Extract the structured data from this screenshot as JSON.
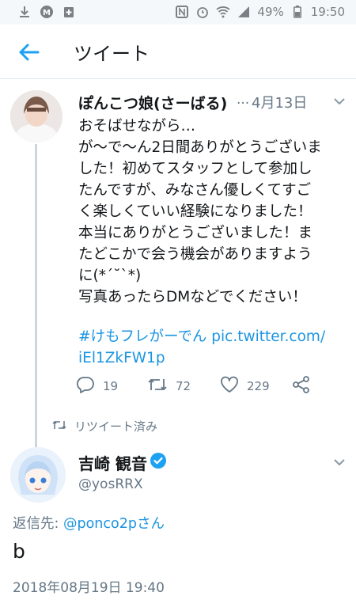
{
  "status_bar": {
    "battery": "49%",
    "time": "19:50",
    "icons": [
      "download-icon",
      "m-icon",
      "plus-box-icon",
      "nfc-icon",
      "alarm-icon",
      "wifi-icon",
      "signal-icon",
      "battery-icon"
    ]
  },
  "header": {
    "title": "ツイート",
    "back_icon": "arrow-left-icon"
  },
  "tweet": {
    "name": "ぽんこつ娘(さーばる)",
    "ellipsis": "...",
    "date": "4月13日",
    "lines": [
      "おそばせながら…",
      "が〜で〜ん2日間ありがとうございま",
      "した！初めてスタッフとして参加し",
      "たんですが、みなさん優しくてすご",
      "く楽しくていい経験になりました！",
      "本当にありがとうございました！ま",
      "たどこかで会う機会がありますよう",
      "に(*´˘`*)",
      "写真あったらDMなどでください！"
    ],
    "hashtag": "#けもフレがーでん",
    "link_part1": "pic.twitter.com/",
    "link_part2": "iEl1ZkFW1p",
    "replies": "19",
    "retweets": "72",
    "likes": "229"
  },
  "retweeted_label": "リツイート済み",
  "reply_tweet": {
    "name": "吉崎 観音",
    "handle": "@yosRRX",
    "reply_prefix": "返信先: ",
    "reply_to": "@ponco2pさん",
    "text": "b",
    "timestamp": "2018年08月19日 19:40"
  },
  "colors": {
    "accent": "#1da1f2",
    "link": "#1b95e0",
    "muted": "#657786",
    "text": "#14171a"
  }
}
